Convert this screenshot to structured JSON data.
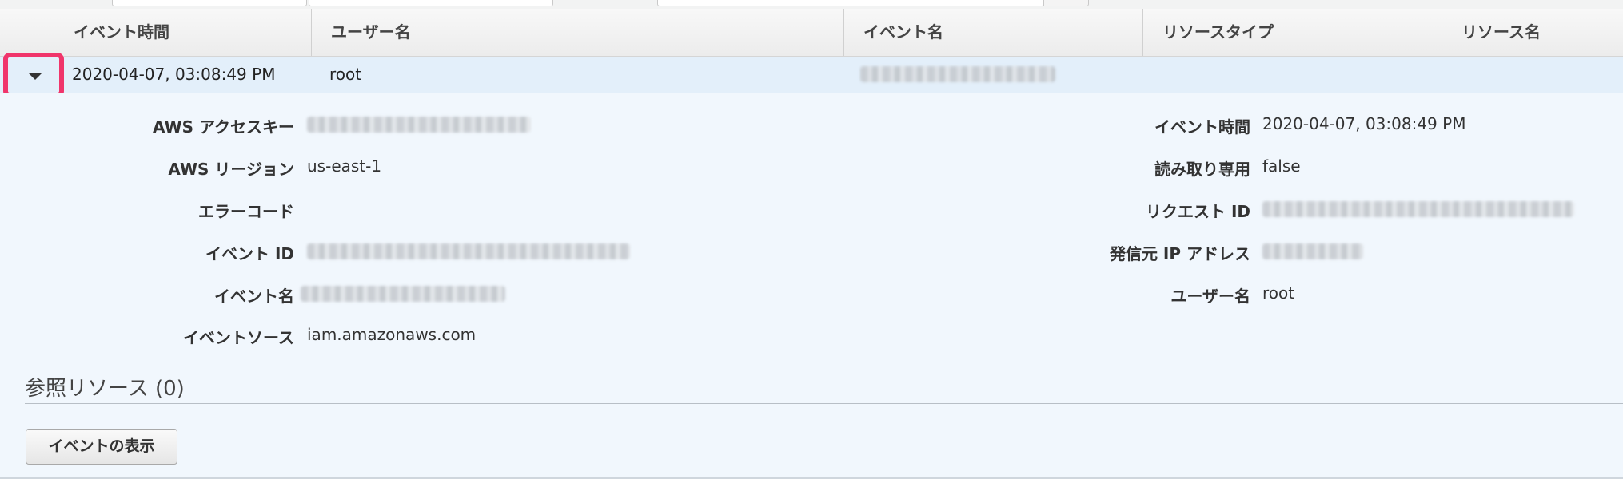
{
  "table": {
    "columns": [
      "イベント時間",
      "ユーザー名",
      "イベント名",
      "リソースタイプ",
      "リソース名"
    ],
    "row": {
      "event_time": "2020-04-07, 03:08:49 PM",
      "user_name": "root",
      "expand_icon": "caret-down-icon"
    }
  },
  "details": {
    "left": [
      {
        "label": "AWS アクセスキー",
        "value": ""
      },
      {
        "label": "AWS リージョン",
        "value": "us-east-1"
      },
      {
        "label": "エラーコード",
        "value": ""
      },
      {
        "label": "イベント ID",
        "value": ""
      },
      {
        "label": "イベント名",
        "value": ""
      },
      {
        "label": "イベントソース",
        "value": "iam.amazonaws.com"
      }
    ],
    "right": [
      {
        "label": "イベント時間",
        "value": "2020-04-07, 03:08:49 PM"
      },
      {
        "label": "読み取り専用",
        "value": "false"
      },
      {
        "label": "リクエスト ID",
        "value": ""
      },
      {
        "label": "発信元 IP アドレス",
        "value": ""
      },
      {
        "label": "ユーザー名",
        "value": "root"
      }
    ]
  },
  "references": {
    "title": "参照リソース (0)"
  },
  "actions": {
    "view_event_label": "イベントの表示"
  },
  "colors": {
    "highlight_border": "#f0356b",
    "row_background": "#e3effa",
    "detail_background": "#f1f7fd"
  }
}
